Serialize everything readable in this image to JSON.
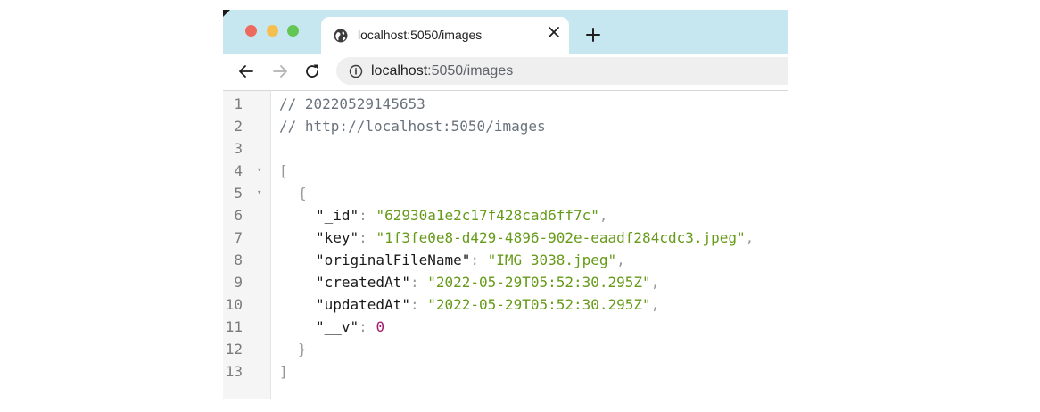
{
  "browser": {
    "window_controls": {
      "close_color": "#ed6a5e",
      "minimize_color": "#f5bf4f",
      "maximize_color": "#62c554"
    },
    "tab": {
      "title": "localhost:5050/images",
      "icon": "globe-icon",
      "close_icon": "close-icon"
    },
    "new_tab_icon": "plus-icon",
    "nav": {
      "back_icon": "arrow-left-icon",
      "forward_icon": "arrow-right-icon",
      "reload_icon": "reload-icon"
    },
    "address_bar": {
      "host": "localhost",
      "rest": ":5050/images",
      "icon": "info-icon"
    }
  },
  "viewer": {
    "lines": [
      {
        "n": "1",
        "comment": "// 20220529145653"
      },
      {
        "n": "2",
        "comment": "// http://localhost:5050/images"
      },
      {
        "n": "3"
      },
      {
        "n": "4",
        "fold": "▾",
        "bracket": "["
      },
      {
        "n": "5",
        "fold": "▾",
        "bracket": "{"
      },
      {
        "n": "6",
        "key": "\"_id\"",
        "value": "\"62930a1e2c17f428cad6ff7c\"",
        "comma": ","
      },
      {
        "n": "7",
        "key": "\"key\"",
        "value": "\"1f3fe0e8-d429-4896-902e-eaadf284cdc3.jpeg\"",
        "comma": ","
      },
      {
        "n": "8",
        "key": "\"originalFileName\"",
        "value": "\"IMG_3038.jpeg\"",
        "comma": ","
      },
      {
        "n": "9",
        "key": "\"createdAt\"",
        "value": "\"2022-05-29T05:52:30.295Z\"",
        "comma": ","
      },
      {
        "n": "10",
        "key": "\"updatedAt\"",
        "value": "\"2022-05-29T05:52:30.295Z\"",
        "comma": ","
      },
      {
        "n": "11",
        "key": "\"__v\"",
        "number": "0"
      },
      {
        "n": "12",
        "bracket": "}"
      },
      {
        "n": "13",
        "bracket": "]"
      }
    ]
  }
}
